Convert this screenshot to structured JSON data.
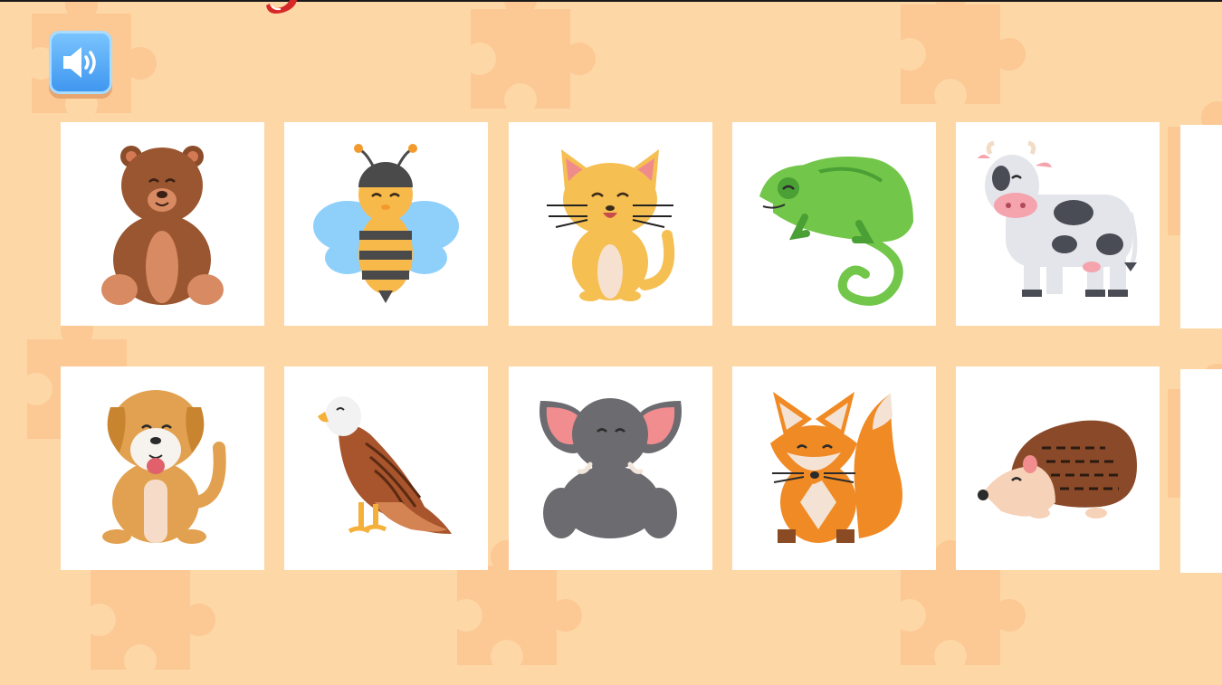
{
  "game": {
    "sound_button": {
      "icon": "speaker-icon",
      "state": "on"
    },
    "cards": [
      {
        "animal": "bear",
        "icon": "bear-icon"
      },
      {
        "animal": "bee",
        "icon": "bee-icon"
      },
      {
        "animal": "cat",
        "icon": "cat-icon"
      },
      {
        "animal": "chameleon",
        "icon": "chameleon-icon"
      },
      {
        "animal": "cow",
        "icon": "cow-icon"
      },
      {
        "animal": "dog",
        "icon": "dog-icon"
      },
      {
        "animal": "eagle",
        "icon": "eagle-icon"
      },
      {
        "animal": "elephant",
        "icon": "elephant-icon"
      },
      {
        "animal": "fox",
        "icon": "fox-icon"
      },
      {
        "animal": "hedgehog",
        "icon": "hedgehog-icon"
      }
    ],
    "colors": {
      "background": "#fdd7a6",
      "puzzle_piece": "#fcc894",
      "card": "#ffffff",
      "sound_button": "#4aa3f5"
    }
  }
}
